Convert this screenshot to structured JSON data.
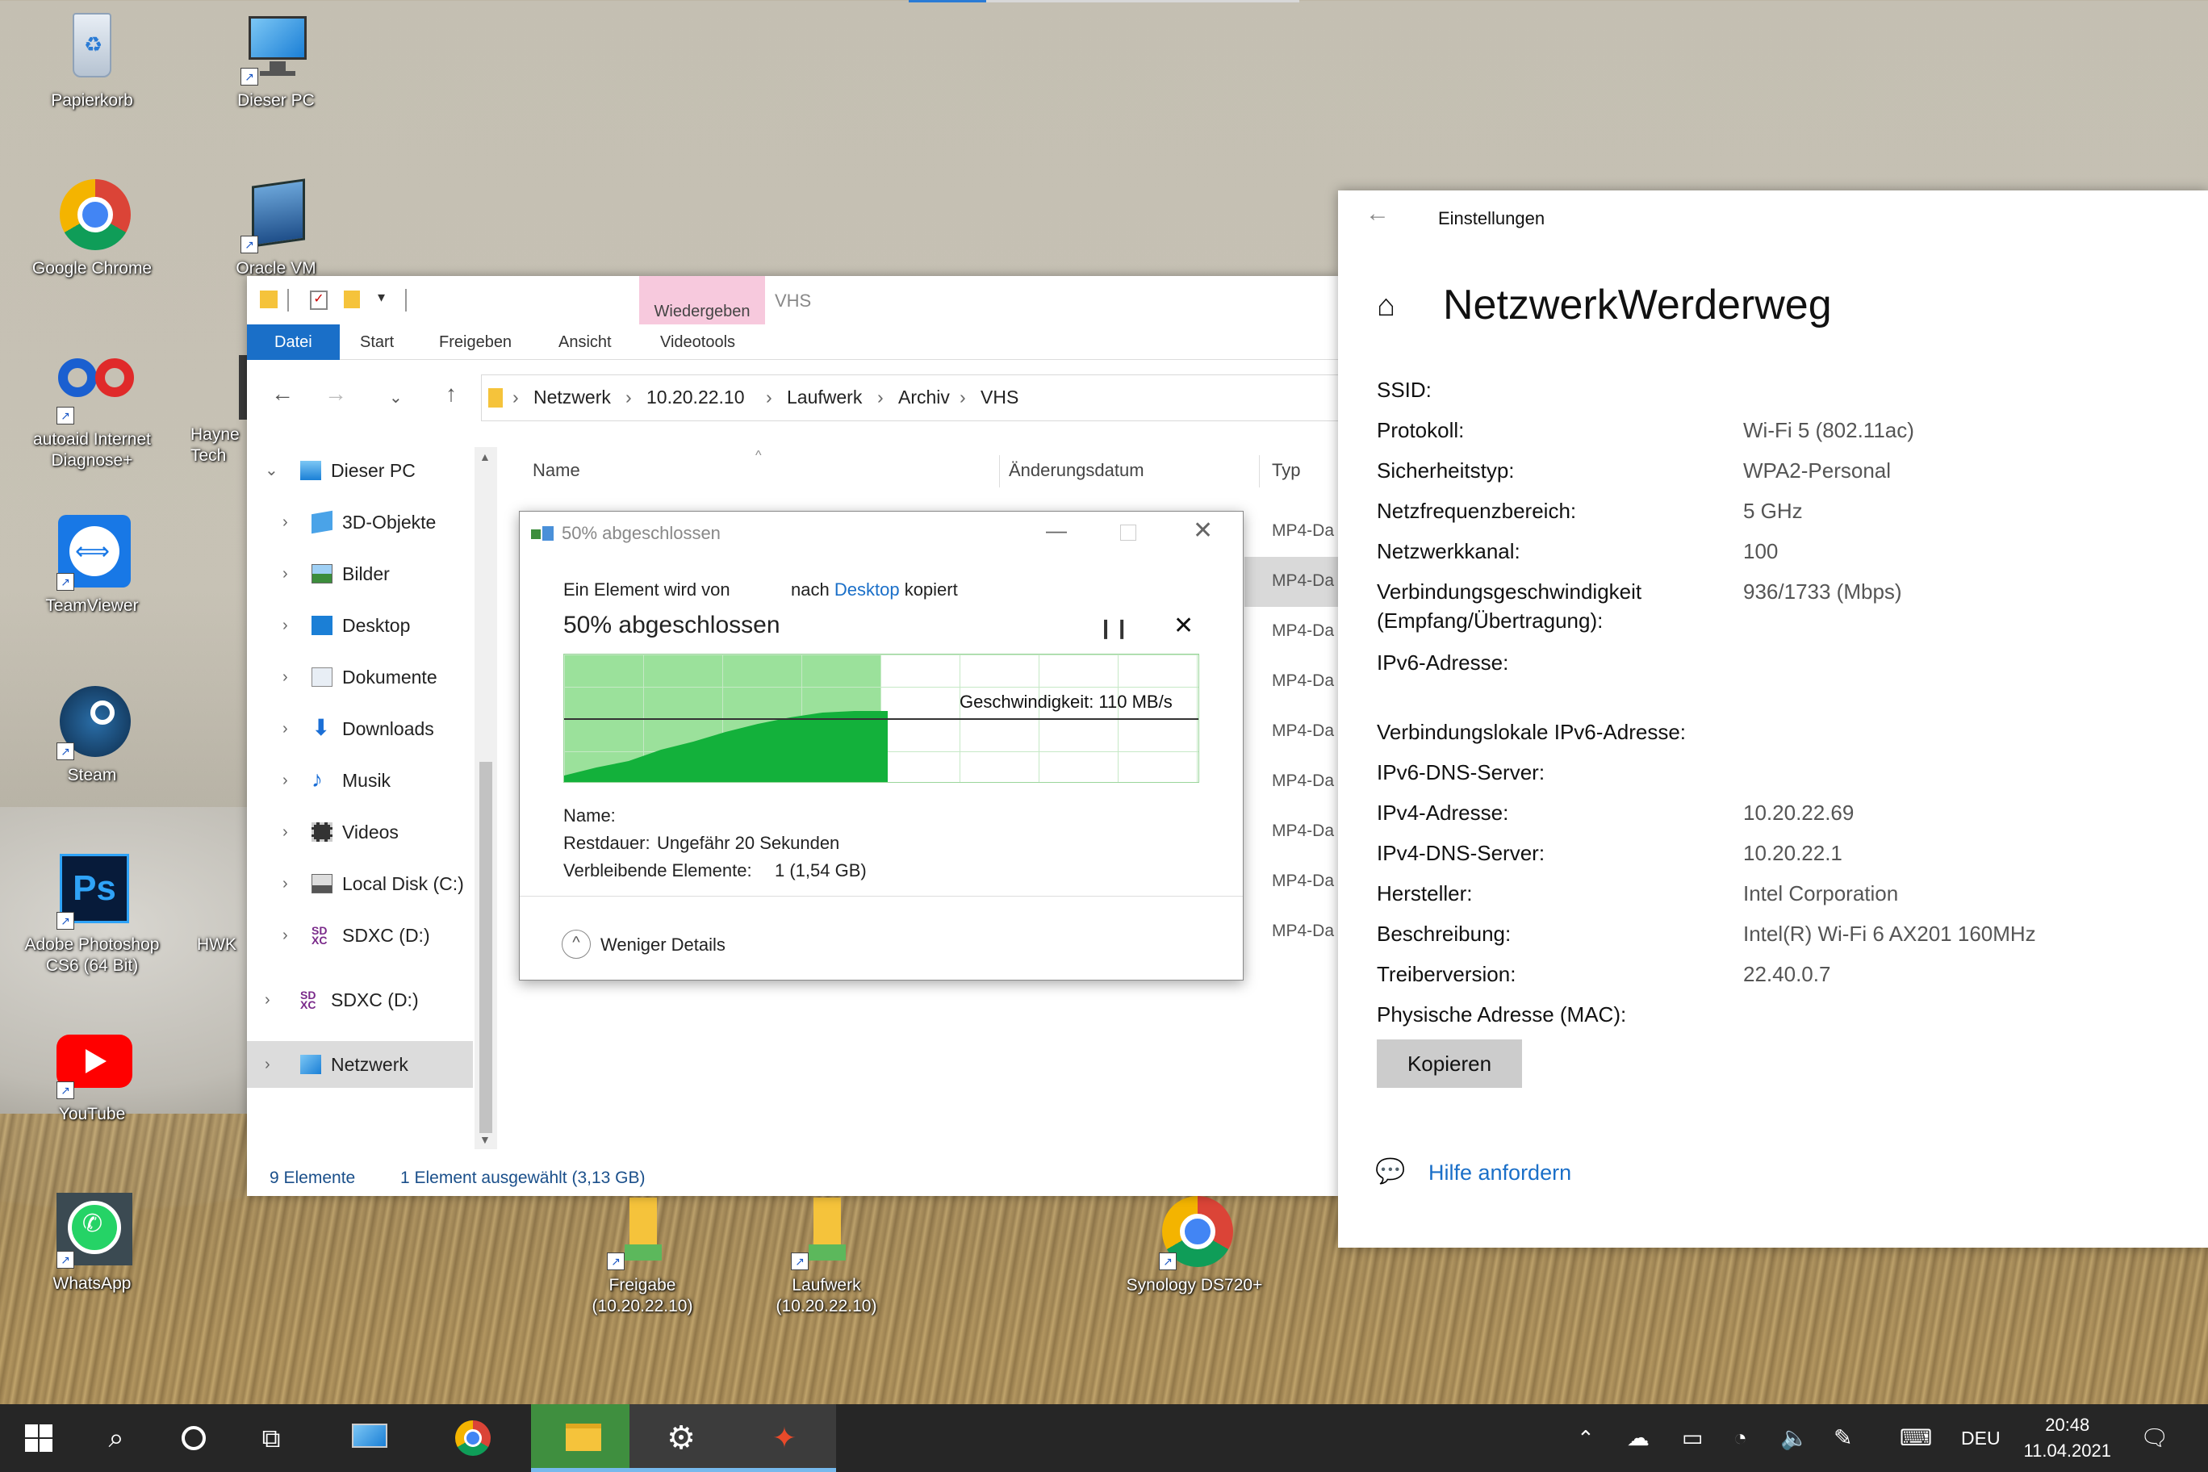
{
  "desktop": {
    "icons": [
      {
        "label": "Papierkorb"
      },
      {
        "label": "Dieser PC"
      },
      {
        "label": "Google Chrome"
      },
      {
        "label": "Oracle VM"
      },
      {
        "label": "autoaid Internet Diagnose+"
      },
      {
        "label": "Hayne Tech"
      },
      {
        "label": "TeamViewer"
      },
      {
        "label": "Steam"
      },
      {
        "label": "Adobe Photoshop CS6 (64 Bit)"
      },
      {
        "label": "HWK"
      },
      {
        "label": "YouTube"
      },
      {
        "label": "WhatsApp"
      },
      {
        "label": "Freigabe (10.20.22.10)"
      },
      {
        "label": "Laufwerk (10.20.22.10)"
      },
      {
        "label": "Synology DS720+"
      }
    ]
  },
  "explorer": {
    "ribbon": {
      "tabs": [
        "Datei",
        "Start",
        "Freigeben",
        "Ansicht",
        "Videotools"
      ],
      "context_group": "Wiedergeben",
      "context_title": "VHS"
    },
    "breadcrumb": [
      "Netzwerk",
      "10.20.22.10",
      "Laufwerk",
      "Archiv",
      "VHS"
    ],
    "columns": {
      "name": "Name",
      "date": "Änderungsdatum",
      "type": "Typ"
    },
    "nav": [
      {
        "label": "Dieser PC",
        "icon": "pc-icon"
      },
      {
        "label": "3D-Objekte",
        "icon": "cube-icon"
      },
      {
        "label": "Bilder",
        "icon": "pictures-icon"
      },
      {
        "label": "Desktop",
        "icon": "desktop-icon"
      },
      {
        "label": "Dokumente",
        "icon": "documents-icon"
      },
      {
        "label": "Downloads",
        "icon": "download-icon"
      },
      {
        "label": "Musik",
        "icon": "music-icon"
      },
      {
        "label": "Videos",
        "icon": "video-icon"
      },
      {
        "label": "Local Disk (C:)",
        "icon": "disk-icon"
      },
      {
        "label": "SDXC (D:)",
        "icon": "sdcard-icon"
      },
      {
        "label": "SDXC (D:)",
        "icon": "sdcard-icon"
      },
      {
        "label": "Netzwerk",
        "icon": "network-icon"
      }
    ],
    "file_types": [
      "MP4-Da",
      "MP4-Da",
      "MP4-Da",
      "MP4-Da",
      "MP4-Da",
      "MP4-Da",
      "MP4-Da",
      "MP4-Da",
      "MP4-Da"
    ],
    "status": {
      "count": "9 Elemente",
      "selection": "1 Element ausgewählt (3,13 GB)"
    }
  },
  "copy_dialog": {
    "title": "50% abgeschlossen",
    "line_from": "Ein Element wird von",
    "line_to": "nach",
    "destination_link": "Desktop",
    "line_end": "kopiert",
    "heading": "50% abgeschlossen",
    "progress": 0.5,
    "speed_label": "Geschwindigkeit: 110 MB/s",
    "name_label": "Name:",
    "remaining_time_label": "Restdauer:",
    "remaining_time_value": "Ungefähr 20 Sekunden",
    "remaining_items_label": "Verbleibende Elemente:",
    "remaining_items_value": "1 (1,54 GB)",
    "less_details": "Weniger Details"
  },
  "settings": {
    "app_title": "Einstellungen",
    "page_title": "NetzwerkWerderweg",
    "rows": [
      {
        "key": "SSID:",
        "value": ""
      },
      {
        "key": "Protokoll:",
        "value": "Wi-Fi 5 (802.11ac)"
      },
      {
        "key": "Sicherheitstyp:",
        "value": "WPA2-Personal"
      },
      {
        "key": "Netzfrequenzbereich:",
        "value": "5 GHz"
      },
      {
        "key": "Netzwerkkanal:",
        "value": "100"
      },
      {
        "key": "Verbindungsgeschwindigkeit",
        "value": "936/1733 (Mbps)"
      },
      {
        "key": "(Empfang/Übertragung):",
        "value": ""
      },
      {
        "key": "IPv6-Adresse:",
        "value": ""
      },
      {
        "key": "Verbindungslokale IPv6-Adresse:",
        "value": ""
      },
      {
        "key": "IPv6-DNS-Server:",
        "value": ""
      },
      {
        "key": "IPv4-Adresse:",
        "value": "10.20.22.69"
      },
      {
        "key": "IPv4-DNS-Server:",
        "value": "10.20.22.1"
      },
      {
        "key": "Hersteller:",
        "value": "Intel Corporation"
      },
      {
        "key": "Beschreibung:",
        "value": "Intel(R) Wi-Fi 6 AX201 160MHz"
      },
      {
        "key": "Treiberversion:",
        "value": "22.40.0.7"
      },
      {
        "key": "Physische Adresse (MAC):",
        "value": ""
      }
    ],
    "copy_button": "Kopieren",
    "help_link": "Hilfe anfordern"
  },
  "taskbar": {
    "language": "DEU",
    "time": "20:48",
    "date": "11.04.2021"
  }
}
